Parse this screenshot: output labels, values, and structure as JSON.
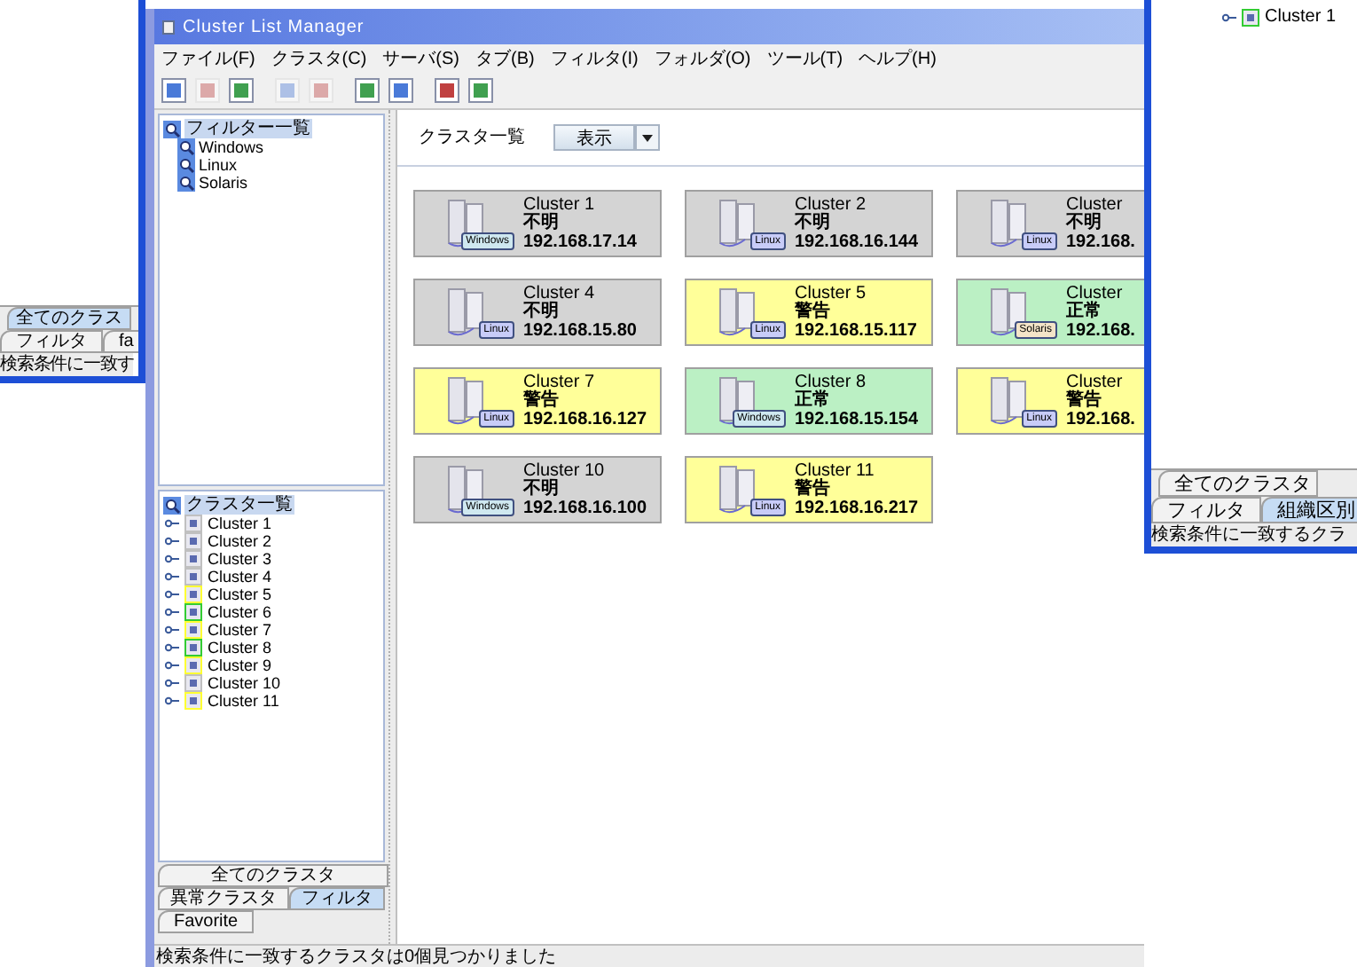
{
  "back_left_window": {
    "tabs": [
      {
        "label": "全てのクラス",
        "selected": true
      },
      {
        "label": "フィルタ",
        "selected": false
      },
      {
        "label": "fa",
        "selected": false
      }
    ],
    "status_bar": "検索条件に一致す"
  },
  "back_right_window": {
    "tree": [
      {
        "label": "Cluster 1",
        "color": "#33cc33"
      }
    ],
    "tabs": [
      {
        "label": "全てのクラスタ",
        "selected": false
      },
      {
        "label": "フィルタ",
        "selected": false
      },
      {
        "label": "組織区別",
        "selected": true
      }
    ],
    "status_bar": "検索条件に一致するクラ"
  },
  "window": {
    "title": "Cluster List Manager"
  },
  "menu": [
    "ファイル(F)",
    "クラスタ(C)",
    "サーバ(S)",
    "タブ(B)",
    "フィルタ(I)",
    "フォルダ(O)",
    "ツール(T)",
    "ヘルプ(H)"
  ],
  "toolbar": [
    {
      "disabled": false
    },
    {
      "disabled": true
    },
    {
      "disabled": false
    },
    {
      "disabled": true
    },
    {
      "disabled": true
    },
    {
      "disabled": false
    },
    {
      "disabled": false
    },
    {
      "disabled": false
    },
    {
      "disabled": false
    }
  ],
  "filter_tree": {
    "label": "フィルター一覧",
    "selected": true,
    "children": [
      {
        "label": "Windows"
      },
      {
        "label": "Linux"
      },
      {
        "label": "Solaris"
      }
    ]
  },
  "cluster_tree": {
    "label": "クラスタ一覧",
    "selected": true,
    "children": [
      {
        "label": "Cluster 1",
        "color": "#c0c0c0"
      },
      {
        "label": "Cluster 2",
        "color": "#c0c0c0"
      },
      {
        "label": "Cluster 3",
        "color": "#c0c0c0"
      },
      {
        "label": "Cluster 4",
        "color": "#c0c0c0"
      },
      {
        "label": "Cluster 5",
        "color": "#ffff33"
      },
      {
        "label": "Cluster 6",
        "color": "#33cc33"
      },
      {
        "label": "Cluster 7",
        "color": "#ffff33"
      },
      {
        "label": "Cluster 8",
        "color": "#33cc33"
      },
      {
        "label": "Cluster 9",
        "color": "#ffff33"
      },
      {
        "label": "Cluster 10",
        "color": "#c0c0c0"
      },
      {
        "label": "Cluster 11",
        "color": "#ffff33"
      }
    ]
  },
  "tab_rows": [
    {
      "tabs": [
        {
          "label": "全てのクラスタ",
          "selected": false
        }
      ]
    },
    {
      "tabs": [
        {
          "label": "異常クラスタ",
          "selected": false
        },
        {
          "label": "フィルタ",
          "selected": true
        }
      ]
    },
    {
      "tabs": [
        {
          "label": "Favorite",
          "selected": false
        }
      ]
    }
  ],
  "content": {
    "title": "クラスタ一覧",
    "view_button": "表示",
    "clusters": [
      {
        "name": "Cluster 1",
        "status": "不明",
        "ip": "192.168.17.14",
        "os": "Windows",
        "color": "#d4d4d4"
      },
      {
        "name": "Cluster 2",
        "status": "不明",
        "ip": "192.168.16.144",
        "os": "Linux",
        "color": "#d4d4d4"
      },
      {
        "name": "Cluster",
        "status": "不明",
        "ip": "192.168.",
        "os": "Linux",
        "color": "#d4d4d4"
      },
      {
        "name": "Cluster 4",
        "status": "不明",
        "ip": "192.168.15.80",
        "os": "Linux",
        "color": "#d4d4d4"
      },
      {
        "name": "Cluster 5",
        "status": "警告",
        "ip": "192.168.15.117",
        "os": "Linux",
        "color": "#ffff99"
      },
      {
        "name": "Cluster",
        "status": "正常",
        "ip": "192.168.",
        "os": "Solaris",
        "color": "#bbf0c4"
      },
      {
        "name": "Cluster 7",
        "status": "警告",
        "ip": "192.168.16.127",
        "os": "Linux",
        "color": "#ffff99"
      },
      {
        "name": "Cluster 8",
        "status": "正常",
        "ip": "192.168.15.154",
        "os": "Windows",
        "color": "#bbf0c4"
      },
      {
        "name": "Cluster",
        "status": "警告",
        "ip": "192.168.",
        "os": "Linux",
        "color": "#ffff99"
      },
      {
        "name": "Cluster 10",
        "status": "不明",
        "ip": "192.168.16.100",
        "os": "Windows",
        "color": "#d4d4d4"
      },
      {
        "name": "Cluster 11",
        "status": "警告",
        "ip": "192.168.16.217",
        "os": "Linux",
        "color": "#ffff99"
      }
    ]
  },
  "status_bar": "検索条件に一致するクラスタは0個見つかりました"
}
